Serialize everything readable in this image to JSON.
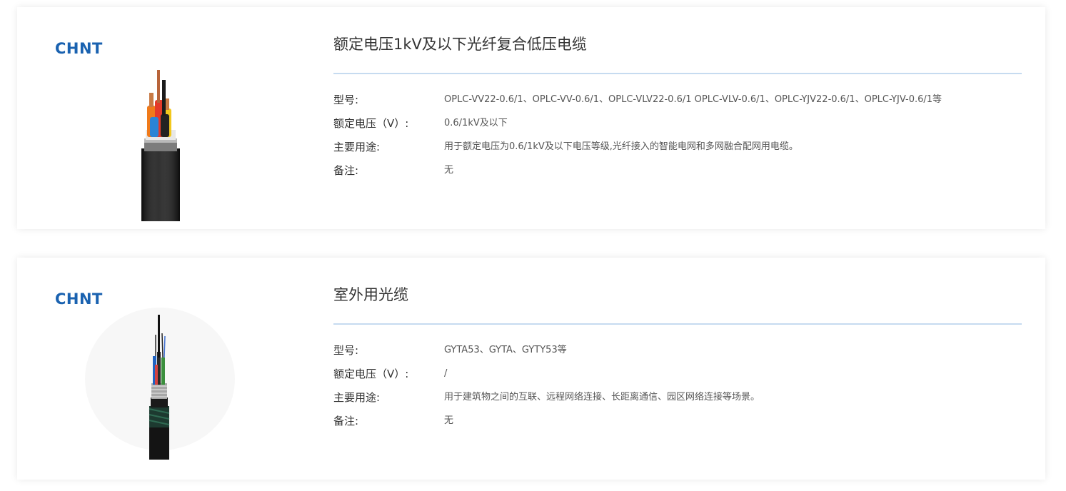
{
  "products": [
    {
      "brand": "CHNT",
      "title": "额定电压1kV及以下光纤复合低压电缆",
      "image_icon": "power-cable-icon",
      "specs": {
        "model_label": "型号:",
        "model_value": "OPLC-VV22-0.6/1、OPLC-VV-0.6/1、OPLC-VLV22-0.6/1 OPLC-VLV-0.6/1、OPLC-YJV22-0.6/1、OPLC-YJV-0.6/1等",
        "voltage_label": "额定电压（V）:",
        "voltage_value": "0.6/1kV及以下",
        "usage_label": "主要用途:",
        "usage_value": "用于额定电压为0.6/1kV及以下电压等级,光纤接入的智能电网和多网融合配网用电缆。",
        "note_label": "备注:",
        "note_value": "无"
      }
    },
    {
      "brand": "CHNT",
      "title": "室外用光缆",
      "image_icon": "fiber-optic-cable-icon",
      "specs": {
        "model_label": "型号:",
        "model_value": "GYTA53、GYTA、GYTY53等",
        "voltage_label": "额定电压（V）:",
        "voltage_value": "/",
        "usage_label": "主要用途:",
        "usage_value": "用于建筑物之间的互联、远程网络连接、长距离通信、园区网络连接等场景。",
        "note_label": "备注:",
        "note_value": "无"
      }
    }
  ],
  "colors": {
    "brand_blue": "#1a62b0",
    "divider": "#c6dbf0",
    "text_dark": "#333333",
    "text_value": "#555555"
  }
}
